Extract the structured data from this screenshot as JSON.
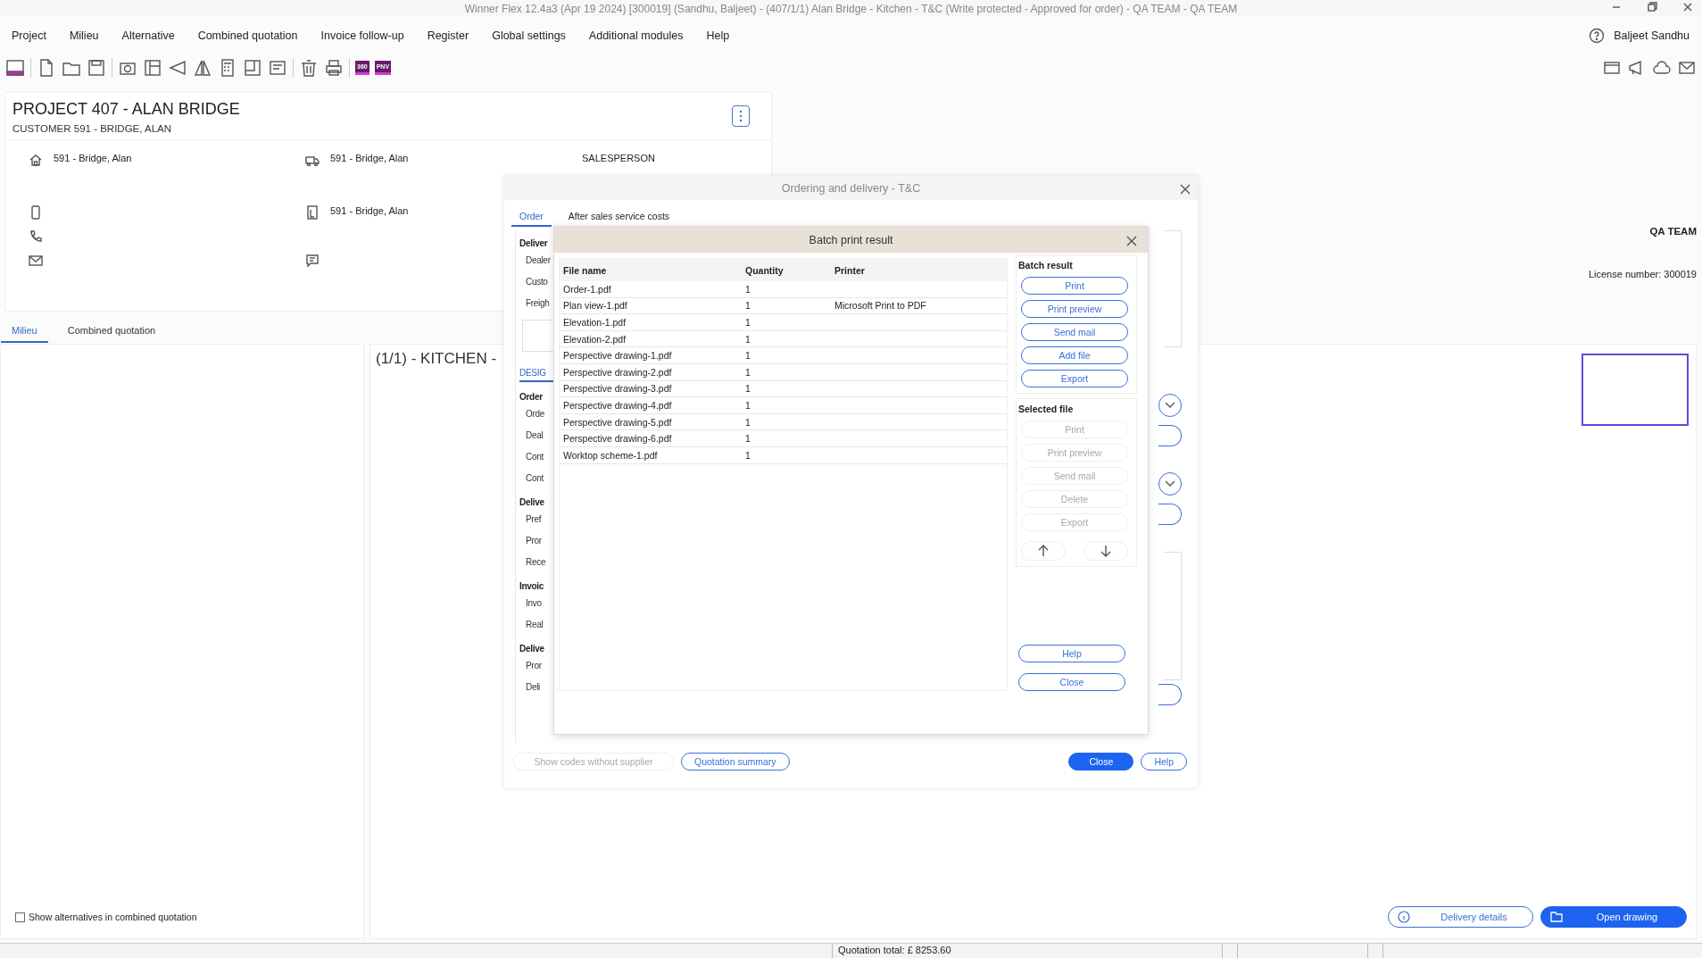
{
  "window": {
    "title": "Winner Flex 12.4a3  (Apr 19 2024) [300019]  (Sandhu, Baljeet) - (407/1/1) Alan Bridge - Kitchen - T&C (Write protected - Approved for order) - QA TEAM  - QA TEAM"
  },
  "menu": [
    {
      "label": "Project"
    },
    {
      "label": "Milieu"
    },
    {
      "label": "Alternative"
    },
    {
      "label": "Combined quotation"
    },
    {
      "label": "Invoice follow-up"
    },
    {
      "label": "Register"
    },
    {
      "label": "Global settings"
    },
    {
      "label": "Additional modules"
    },
    {
      "label": "Help"
    }
  ],
  "user": "Baljeet Sandhu",
  "toolbar": {
    "badges": [
      "360",
      "PNV"
    ]
  },
  "project": {
    "title": "PROJECT 407 - ALAN BRIDGE",
    "customer": "CUSTOMER 591 - BRIDGE, ALAN",
    "home_address": "591 - Bridge, Alan",
    "delivery_address": "591 - Bridge, Alan",
    "invoice_address": "591 - Bridge, Alan",
    "salesperson_label": "SALESPERSON"
  },
  "org": "QA TEAM",
  "license": "License number: 300019",
  "tabs": [
    {
      "label": "Milieu",
      "selected": true
    },
    {
      "label": "Combined quotation",
      "selected": false
    }
  ],
  "alternative_title": "(1/1)  - KITCHEN -",
  "show_alternatives": {
    "label": "Show alternatives in combined quotation",
    "checked": false
  },
  "actions": [
    {
      "label": "Delivery details",
      "primary": false
    },
    {
      "label": "Open drawing",
      "primary": true
    }
  ],
  "status_bar": {
    "quotation_total": "Quotation total: £ 8253.60"
  },
  "ordering_dialog": {
    "title": "Ordering and delivery - T&C",
    "tabs": [
      {
        "label": "Order",
        "selected": true
      },
      {
        "label": "After sales service costs",
        "selected": false
      }
    ],
    "labels": [
      {
        "kind": "heading",
        "text": "Deliver"
      },
      {
        "kind": "field",
        "text": "Dealer"
      },
      {
        "kind": "field",
        "text": "Custo"
      },
      {
        "kind": "field",
        "text": "Freigh"
      },
      {
        "kind": "box"
      },
      {
        "kind": "tab",
        "text": "DESIG"
      },
      {
        "kind": "heading",
        "text": "Order"
      },
      {
        "kind": "field",
        "text": "Orde"
      },
      {
        "kind": "field",
        "text": "Deal"
      },
      {
        "kind": "field",
        "text": "Cont"
      },
      {
        "kind": "field",
        "text": "Cont"
      },
      {
        "kind": "heading",
        "text": "Delive"
      },
      {
        "kind": "field",
        "text": "Pref"
      },
      {
        "kind": "field",
        "text": "Pror"
      },
      {
        "kind": "field",
        "text": "Rece"
      },
      {
        "kind": "heading",
        "text": "Invoic"
      },
      {
        "kind": "field",
        "text": "Invo"
      },
      {
        "kind": "field",
        "text": "Real"
      },
      {
        "kind": "heading",
        "text": "Delive"
      },
      {
        "kind": "field",
        "text": "Pror"
      },
      {
        "kind": "field",
        "text": "Deli"
      }
    ],
    "buttons": [
      {
        "label": "Show codes without supplier",
        "primary": false,
        "disabled": true
      },
      {
        "label": "Quotation summary",
        "primary": false,
        "disabled": false
      },
      {
        "label": "Close",
        "primary": true,
        "disabled": false
      },
      {
        "label": "Help",
        "primary": false,
        "disabled": false
      }
    ]
  },
  "batch_dialog": {
    "title": "Batch print result",
    "columns": [
      "File name",
      "Quantity",
      "Printer"
    ],
    "rows": [
      {
        "file": "Order-1.pdf",
        "quantity": "1"
      },
      {
        "file": "Plan view-1.pdf",
        "quantity": "1",
        "printer": "Microsoft Print to PDF"
      },
      {
        "file": "Elevation-1.pdf",
        "quantity": "1"
      },
      {
        "file": "Elevation-2.pdf",
        "quantity": "1"
      },
      {
        "file": "Perspective drawing-1.pdf",
        "quantity": "1"
      },
      {
        "file": "Perspective drawing-2.pdf",
        "quantity": "1"
      },
      {
        "file": "Perspective drawing-3.pdf",
        "quantity": "1"
      },
      {
        "file": "Perspective drawing-4.pdf",
        "quantity": "1"
      },
      {
        "file": "Perspective drawing-5.pdf",
        "quantity": "1"
      },
      {
        "file": "Perspective drawing-6.pdf",
        "quantity": "1"
      },
      {
        "file": "Worktop scheme-1.pdf",
        "quantity": "1"
      }
    ],
    "batch_group": {
      "title": "Batch result",
      "buttons": [
        {
          "label": "Print",
          "disabled": false
        },
        {
          "label": "Print preview",
          "disabled": false
        },
        {
          "label": "Send mail",
          "disabled": false
        },
        {
          "label": "Add file",
          "disabled": false
        },
        {
          "label": "Export",
          "disabled": false
        }
      ]
    },
    "selected_group": {
      "title": "Selected file",
      "buttons": [
        {
          "label": "Print",
          "disabled": true
        },
        {
          "label": "Print preview",
          "disabled": true
        },
        {
          "label": "Send mail",
          "disabled": true
        },
        {
          "label": "Delete",
          "disabled": true
        },
        {
          "label": "Export",
          "disabled": true
        }
      ]
    },
    "footer_buttons": [
      {
        "label": "Help"
      },
      {
        "label": "Close"
      }
    ]
  }
}
